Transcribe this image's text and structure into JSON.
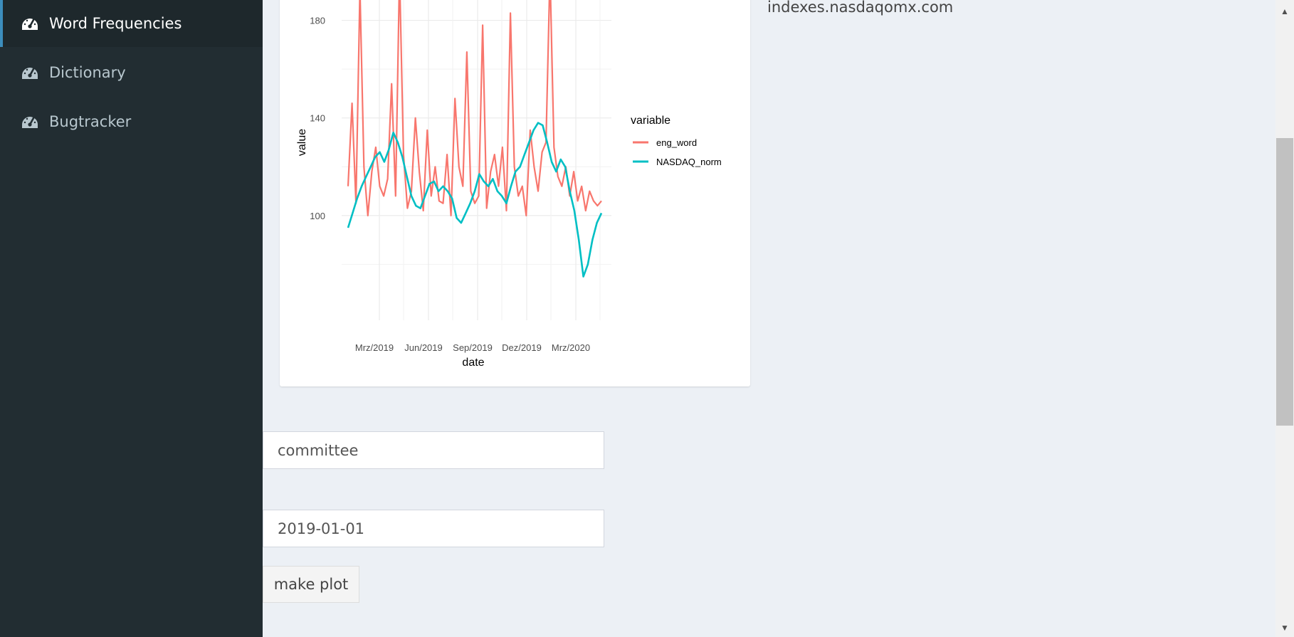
{
  "sidebar": {
    "items": [
      {
        "label": "Word Frequencies",
        "icon": "dashboard-icon",
        "active": true
      },
      {
        "label": "Dictionary",
        "icon": "dashboard-icon",
        "active": false
      },
      {
        "label": "Bugtracker",
        "icon": "dashboard-icon",
        "active": false
      }
    ]
  },
  "source_text": "indexes.nasdaqomx.com",
  "form": {
    "word_value": "committee",
    "date_value": "2019-01-01",
    "button_label": "make plot"
  },
  "colors": {
    "sidebar_bg": "#222d32",
    "accent": "#3c8dbc",
    "series_eng_word": "#F8766D",
    "series_nasdaq": "#00BFC4"
  },
  "chart_data": {
    "type": "line",
    "xlabel": "date",
    "ylabel": "value",
    "x_ticks": [
      "Mrz/2019",
      "Jun/2019",
      "Sep/2019",
      "Dez/2019",
      "Mrz/2020"
    ],
    "y_ticks": [
      100,
      140,
      180
    ],
    "ylim": [
      60,
      200
    ],
    "legend_title": "variable",
    "legend_position": "right",
    "grid": true,
    "series": [
      {
        "name": "eng_word",
        "color": "#F8766D",
        "values_sampled_weekly": [
          112,
          146,
          105,
          193,
          120,
          100,
          118,
          128,
          112,
          108,
          115,
          154,
          108,
          200,
          125,
          103,
          110,
          140,
          118,
          102,
          135,
          108,
          120,
          106,
          105,
          125,
          100,
          148,
          120,
          112,
          167,
          110,
          105,
          108,
          178,
          103,
          118,
          125,
          112,
          128,
          102,
          183,
          120,
          108,
          112,
          100,
          135,
          120,
          110,
          126,
          130,
          200,
          128,
          116,
          112,
          120,
          108,
          118,
          106,
          112,
          102,
          110,
          106,
          104,
          106
        ]
      },
      {
        "name": "NASDAQ_norm",
        "color": "#00BFC4",
        "values_sampled_weekly": [
          95,
          101,
          107,
          112,
          116,
          120,
          124,
          126,
          122,
          127,
          134,
          130,
          124,
          116,
          108,
          104,
          103,
          108,
          113,
          114,
          110,
          112,
          110,
          107,
          99,
          97,
          101,
          105,
          110,
          117,
          114,
          112,
          115,
          110,
          108,
          105,
          112,
          118,
          120,
          125,
          130,
          135,
          138,
          137,
          130,
          122,
          118,
          123,
          120,
          110,
          102,
          90,
          75,
          80,
          90,
          97,
          101
        ]
      }
    ]
  }
}
